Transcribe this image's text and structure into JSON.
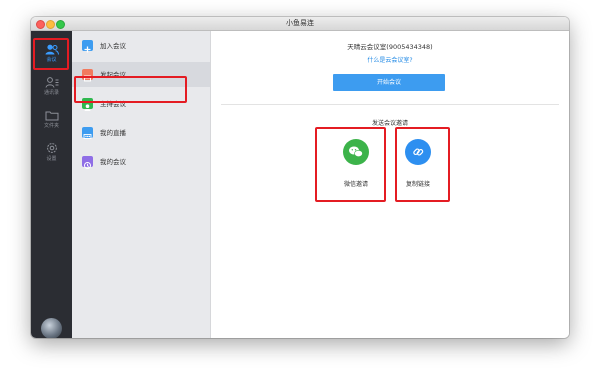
{
  "window": {
    "title": "小鱼易连"
  },
  "rail": {
    "items": [
      {
        "label": "会议",
        "icon": "people-icon",
        "active": true
      },
      {
        "label": "通讯录",
        "icon": "contacts-icon"
      },
      {
        "label": "文件夹",
        "icon": "folder-icon"
      },
      {
        "label": "设置",
        "icon": "gear-icon"
      }
    ]
  },
  "menu": {
    "items": [
      {
        "label": "加入会议",
        "icon": "join-icon",
        "color": "#3d9cf0"
      },
      {
        "label": "发起会议",
        "icon": "start-meeting-icon",
        "color": "#f27a5e"
      },
      {
        "label": "主持会议",
        "icon": "host-icon",
        "color": "#2fb84f"
      },
      {
        "label": "我的直播",
        "icon": "live-icon",
        "color": "#3d9cf0"
      },
      {
        "label": "我的会议",
        "icon": "my-meeting-icon",
        "color": "#8f6ee6"
      }
    ]
  },
  "main": {
    "room_title": "天晴云会议室(9005434348)",
    "room_link": "什么是云会议室?",
    "start_button": "开始会议",
    "invite_title": "发送会议邀请",
    "share": [
      {
        "label": "微信邀请",
        "icon": "wechat-icon",
        "color": "#3cb34a"
      },
      {
        "label": "复制链接",
        "icon": "link-icon",
        "color": "#2d8ff0"
      }
    ]
  }
}
